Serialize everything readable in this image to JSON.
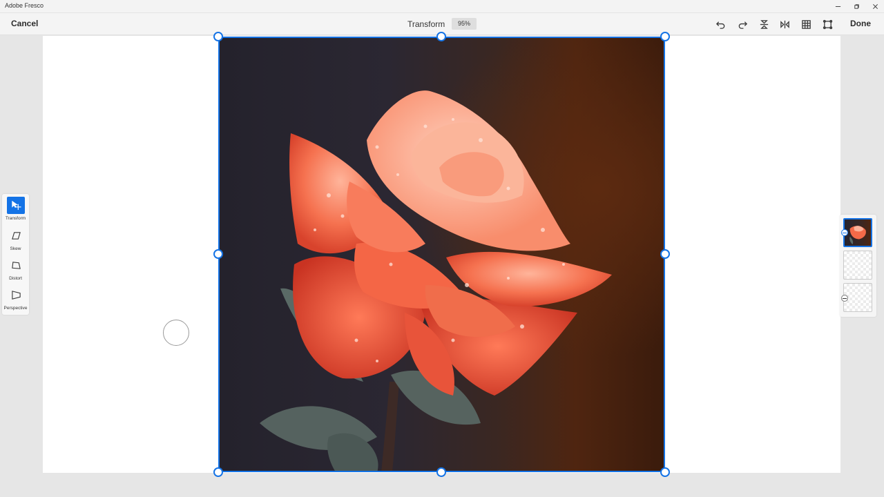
{
  "window": {
    "title": "Adobe Fresco"
  },
  "toolbar": {
    "cancel_label": "Cancel",
    "mode_title": "Transform",
    "zoom": "95%",
    "done_label": "Done",
    "icons": [
      "undo-icon",
      "redo-icon",
      "flip-vertical-icon",
      "flip-horizontal-icon",
      "grid-icon",
      "fit-to-canvas-icon"
    ]
  },
  "tools": {
    "items": [
      {
        "label": "Transform",
        "icon": "transform-move-icon",
        "active": true
      },
      {
        "label": "Skew",
        "icon": "skew-icon",
        "active": false
      },
      {
        "label": "Distort",
        "icon": "distort-icon",
        "active": false
      },
      {
        "label": "Perspective",
        "icon": "perspective-icon",
        "active": false
      }
    ]
  },
  "layers": {
    "count": 3,
    "selected_index": 0
  },
  "colors": {
    "accent": "#1473e6",
    "canvas": "#ffffff",
    "workspace": "#e6e6e6"
  }
}
